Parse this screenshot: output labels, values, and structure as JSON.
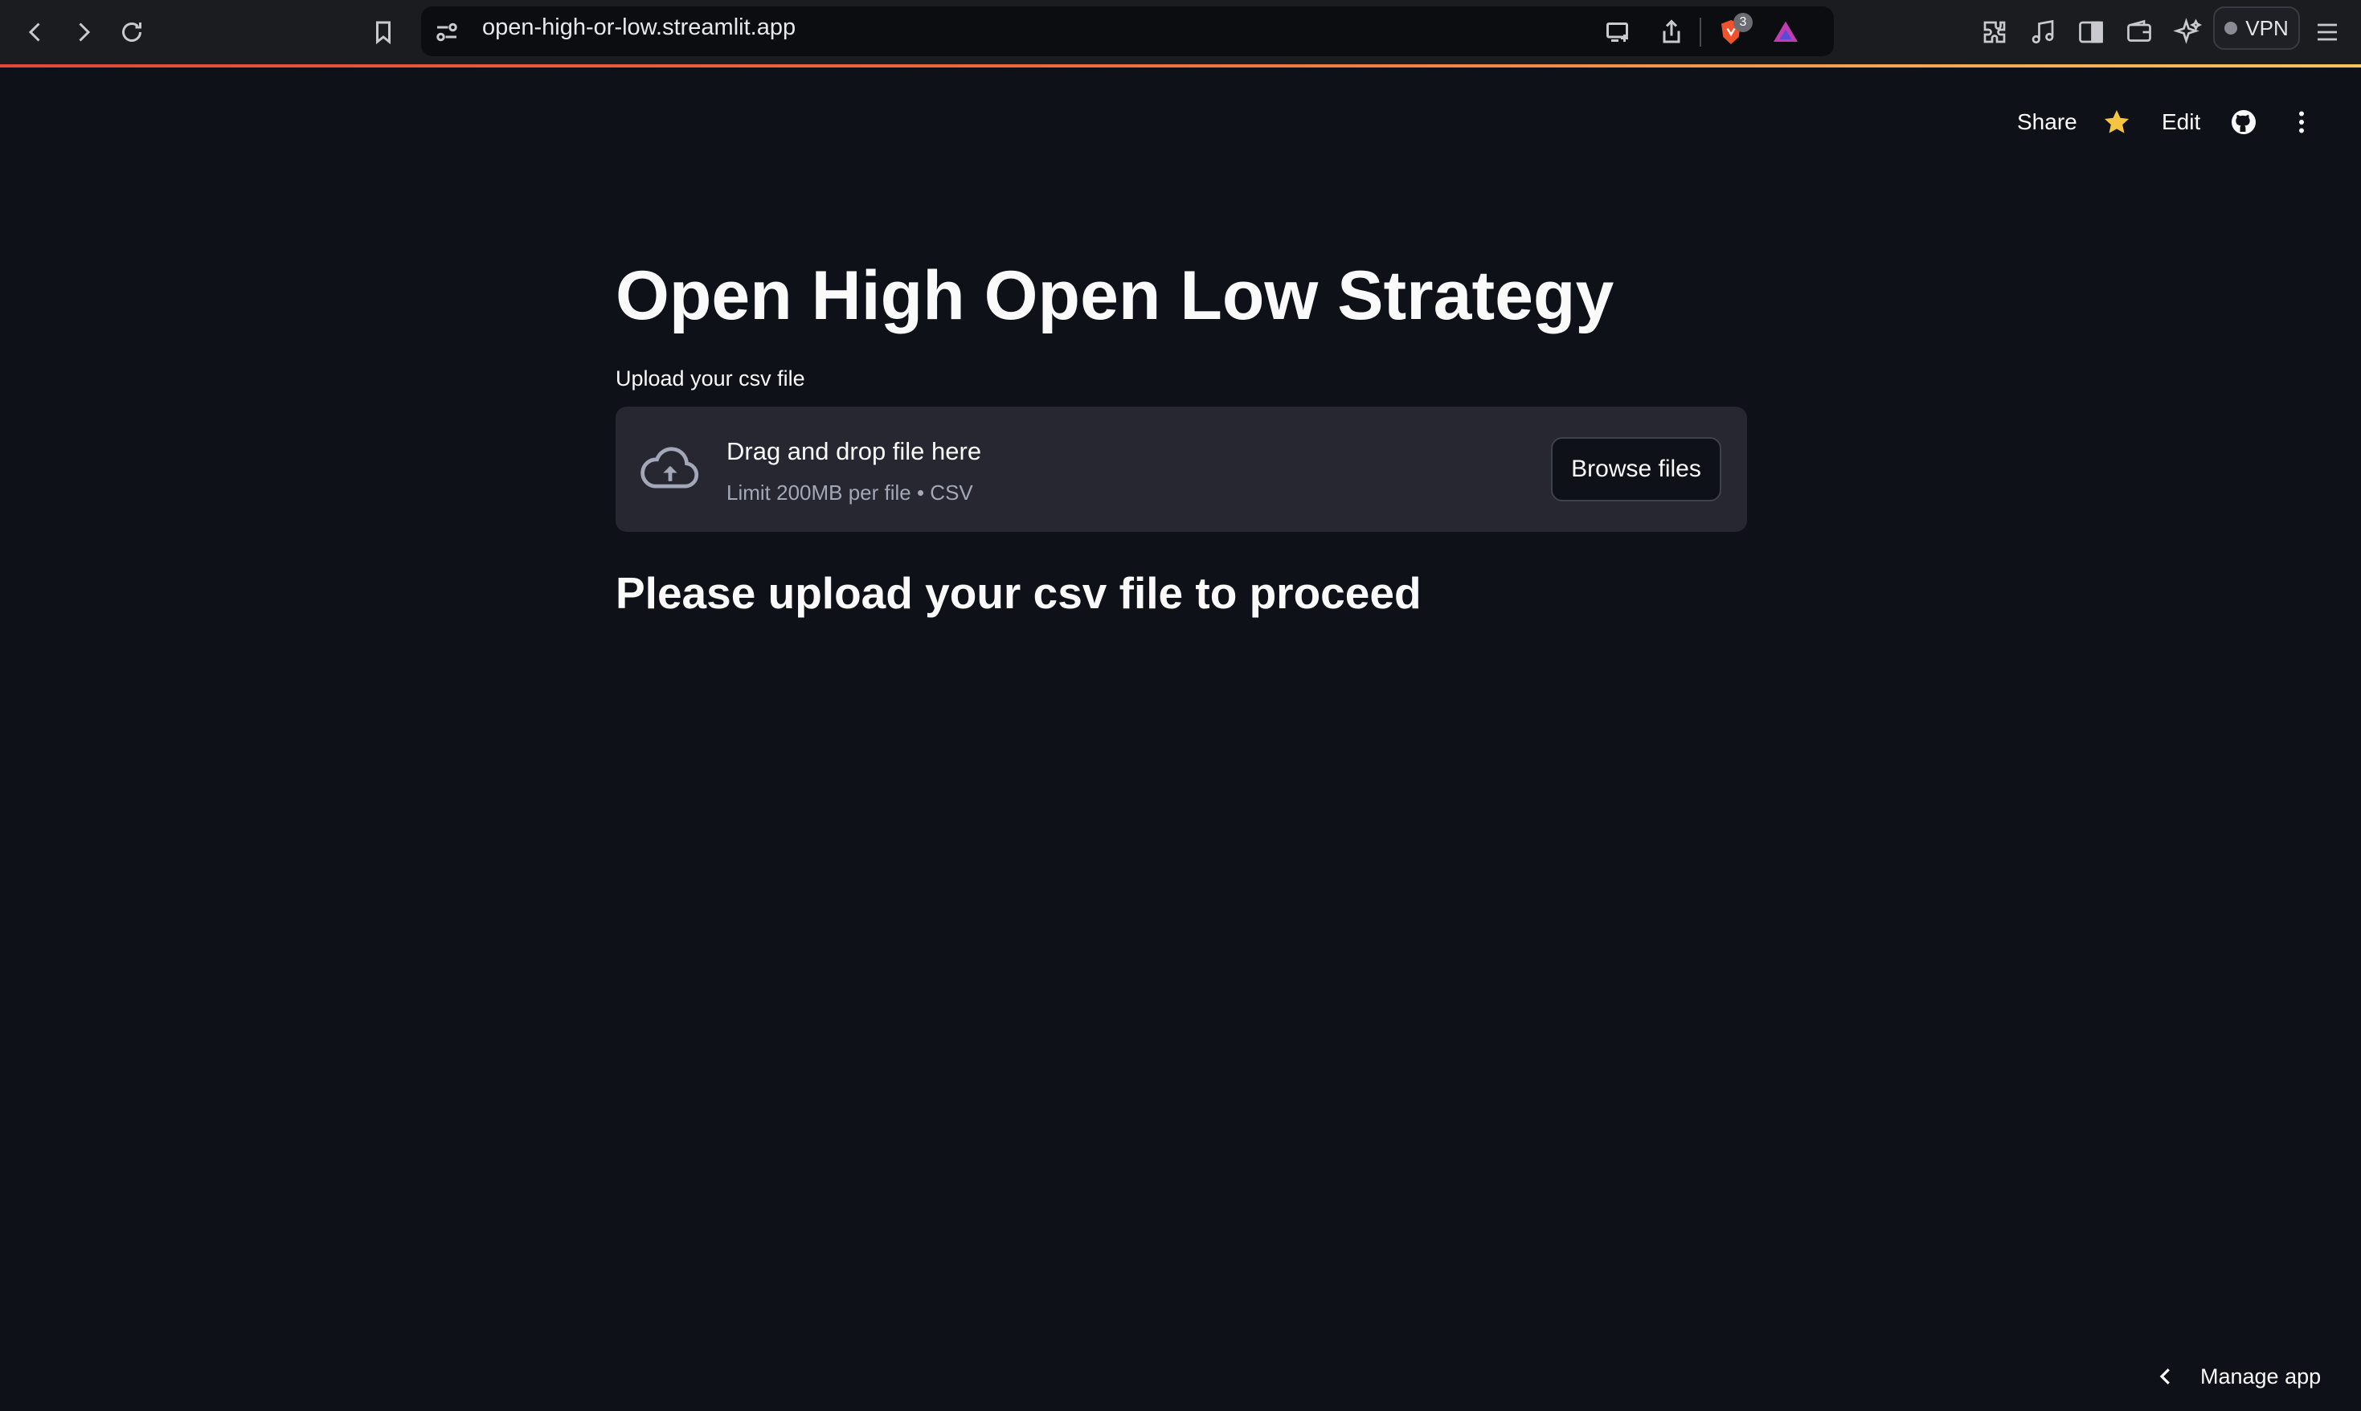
{
  "browser": {
    "url": "open-high-or-low.streamlit.app",
    "brave_badge_count": "3",
    "vpn_label": "VPN",
    "accent_gradient": [
      "#e4473a",
      "#f8c55a"
    ]
  },
  "toolbar": {
    "share_label": "Share",
    "edit_label": "Edit",
    "star_color": "#f5c542"
  },
  "main": {
    "title": "Open High Open Low Strategy",
    "uploader": {
      "label": "Upload your csv file",
      "drop_text": "Drag and drop file here",
      "limit_text": "Limit 200MB per file • CSV",
      "browse_label": "Browse files"
    },
    "message": "Please upload your csv file to proceed"
  },
  "footer": {
    "manage_label": "Manage app"
  }
}
